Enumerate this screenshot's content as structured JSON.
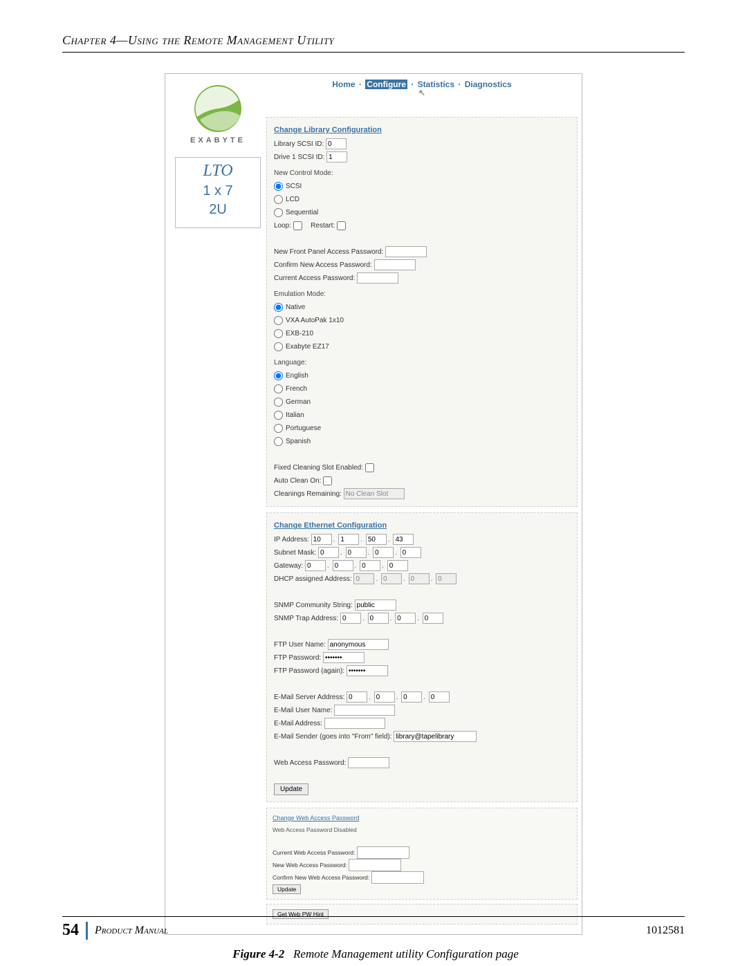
{
  "chapter_header": "Chapter 4—Using the Remote Management Utility",
  "nav": {
    "home": "Home",
    "configure": "Configure",
    "statistics": "Statistics",
    "diagnostics": "Diagnostics",
    "sep": "·"
  },
  "logo": {
    "brand": "EXABYTE",
    "lto": "LTO",
    "config": "1 x 7",
    "height": "2U"
  },
  "libcfg": {
    "heading": "Change Library Configuration",
    "scsi_id_lbl": "Library SCSI ID:",
    "scsi_id": "0",
    "drive_scsi_lbl": "Drive 1 SCSI ID:",
    "drive_scsi": "1",
    "ctrl_mode_lbl": "New Control Mode:",
    "ctrl_modes": [
      "SCSI",
      "LCD",
      "Sequential"
    ],
    "loop_lbl": "Loop:",
    "restart_lbl": "Restart:",
    "new_pw_lbl": "New Front Panel Access Password:",
    "confirm_pw_lbl": "Confirm New Access Password:",
    "current_pw_lbl": "Current Access Password:",
    "emu_lbl": "Emulation Mode:",
    "emu_modes": [
      "Native",
      "VXA AutoPak 1x10",
      "EXB-210",
      "Exabyte EZ17"
    ],
    "lang_lbl": "Language:",
    "langs": [
      "English",
      "French",
      "German",
      "Italian",
      "Portuguese",
      "Spanish"
    ],
    "fixed_clean_lbl": "Fixed Cleaning Slot Enabled:",
    "auto_clean_lbl": "Auto Clean On:",
    "clean_remain_lbl": "Cleanings Remaining:",
    "clean_remain": "No Clean Slot"
  },
  "ethcfg": {
    "heading": "Change Ethernet Configuration",
    "ip_lbl": "IP Address:",
    "ip": [
      "10",
      "1",
      "50",
      "43"
    ],
    "mask_lbl": "Subnet Mask:",
    "mask": [
      "0",
      "0",
      "0",
      "0"
    ],
    "gw_lbl": "Gateway:",
    "gw": [
      "0",
      "0",
      "0",
      "0"
    ],
    "dhcp_lbl": "DHCP assigned Address:",
    "dhcp": [
      "0",
      "0",
      "0",
      "0"
    ],
    "snmp_comm_lbl": "SNMP Community String:",
    "snmp_comm": "public",
    "snmp_trap_lbl": "SNMP Trap Address:",
    "snmp_trap": [
      "0",
      "0",
      "0",
      "0"
    ],
    "ftp_user_lbl": "FTP User Name:",
    "ftp_user": "anonymous",
    "ftp_pw_lbl": "FTP Password:",
    "ftp_pw": "•••••••",
    "ftp_pw2_lbl": "FTP Password (again):",
    "ftp_pw2": "•••••••",
    "email_srv_lbl": "E-Mail Server Address:",
    "email_srv": [
      "0",
      "0",
      "0",
      "0"
    ],
    "email_user_lbl": "E-Mail User Name:",
    "email_addr_lbl": "E-Mail Address:",
    "email_sender_lbl": "E-Mail Sender (goes into \"From\" field):",
    "email_sender": "library@tapelibrary",
    "web_pw_lbl": "Web Access Password:",
    "update_btn": "Update"
  },
  "webpw": {
    "heading": "Change Web Access Password",
    "disabled_note": "Web Access Password Disabled",
    "curr_lbl": "Current Web Access Password:",
    "new_lbl": "New Web Access Password:",
    "conf_lbl": "Confirm New Web Access Password:",
    "update_btn": "Update",
    "gethint_btn": "Get Web PW Hint"
  },
  "figure_caption_label": "Figure 4-2",
  "figure_caption_text": "Remote Management utility Configuration page",
  "footer": {
    "page": "54",
    "title": "Product Manual",
    "docnum": "1012581"
  }
}
